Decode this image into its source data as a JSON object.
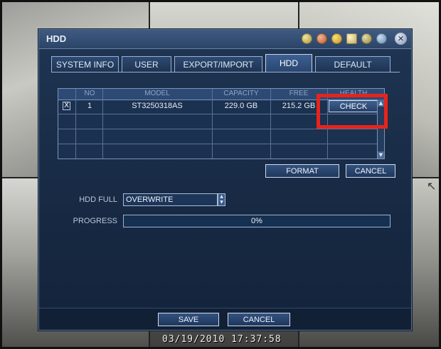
{
  "dialog": {
    "title": "HDD",
    "toolbar_icons": [
      "camera-icon",
      "record-icon",
      "search-icon",
      "network-icon",
      "config-icon",
      "info-icon"
    ],
    "close_icon": "close-icon"
  },
  "tabs": [
    {
      "label": "SYSTEM INFO",
      "active": false
    },
    {
      "label": "USER",
      "active": false
    },
    {
      "label": "EXPORT/IMPORT",
      "active": false
    },
    {
      "label": "HDD",
      "active": true
    },
    {
      "label": "DEFAULT",
      "active": false
    }
  ],
  "hdd_table": {
    "columns": [
      "NO",
      "MODEL",
      "CAPACITY",
      "FREE",
      "HEALTH"
    ],
    "rows": [
      {
        "selected": "X",
        "no": "1",
        "model": "ST3250318AS",
        "capacity": "229.0 GB",
        "free": "215.2 GB",
        "health_action": "CHECK"
      }
    ]
  },
  "actions": {
    "format_label": "FORMAT",
    "cancel_label": "CANCEL"
  },
  "settings": {
    "hdd_full_label": "HDD FULL",
    "hdd_full_value": "OVERWRITE",
    "progress_label": "PROGRESS",
    "progress_text": "0%",
    "progress_value": 0
  },
  "footer": {
    "save_label": "SAVE",
    "cancel_label": "CANCEL"
  },
  "overlay": {
    "timestamp": "03/19/2010 17:37:58"
  },
  "colors": {
    "dialog_bg": "#1f3553",
    "highlight": "#e8231b",
    "progress_fill": "#3d6aa0"
  }
}
